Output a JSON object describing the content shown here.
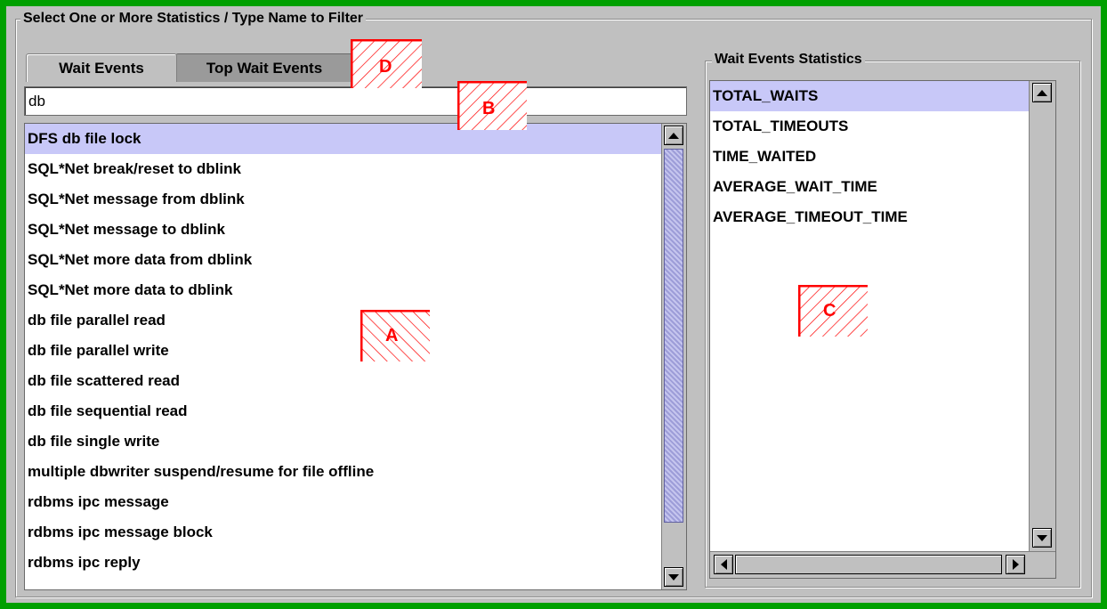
{
  "filter_group": {
    "title": "Select One or More Statistics / Type Name to Filter"
  },
  "tabs": [
    {
      "label": "Wait Events",
      "active": true
    },
    {
      "label": "Top Wait Events",
      "active": false
    }
  ],
  "filter_input": {
    "value": "db"
  },
  "events_list": {
    "items": [
      "DFS db file lock",
      "SQL*Net break/reset to dblink",
      "SQL*Net message from dblink",
      "SQL*Net message to dblink",
      "SQL*Net more data from dblink",
      "SQL*Net more data to dblink",
      "db file parallel read",
      "db file parallel write",
      "db file scattered read",
      "db file sequential read",
      "db file single write",
      "multiple dbwriter suspend/resume for file offline",
      "rdbms ipc message",
      "rdbms ipc message block",
      "rdbms ipc reply"
    ],
    "selected": "DFS db file lock"
  },
  "stats_group": {
    "title": "Wait Events Statistics",
    "items": [
      "TOTAL_WAITS",
      "TOTAL_TIMEOUTS",
      "TIME_WAITED",
      "AVERAGE_WAIT_TIME",
      "AVERAGE_TIMEOUT_TIME"
    ],
    "selected": "TOTAL_WAITS"
  },
  "markers": {
    "a": "A",
    "b": "B",
    "c": "C",
    "d": "D"
  },
  "colors": {
    "frame": "#00a000",
    "panel": "#c0c0c0",
    "selection": "#c8c8f8",
    "marker": "#ff0000"
  },
  "icons": {
    "scroll_up": "scroll-up-arrow-icon",
    "scroll_down": "scroll-down-arrow-icon",
    "scroll_left": "scroll-left-arrow-icon",
    "scroll_right": "scroll-right-arrow-icon"
  }
}
